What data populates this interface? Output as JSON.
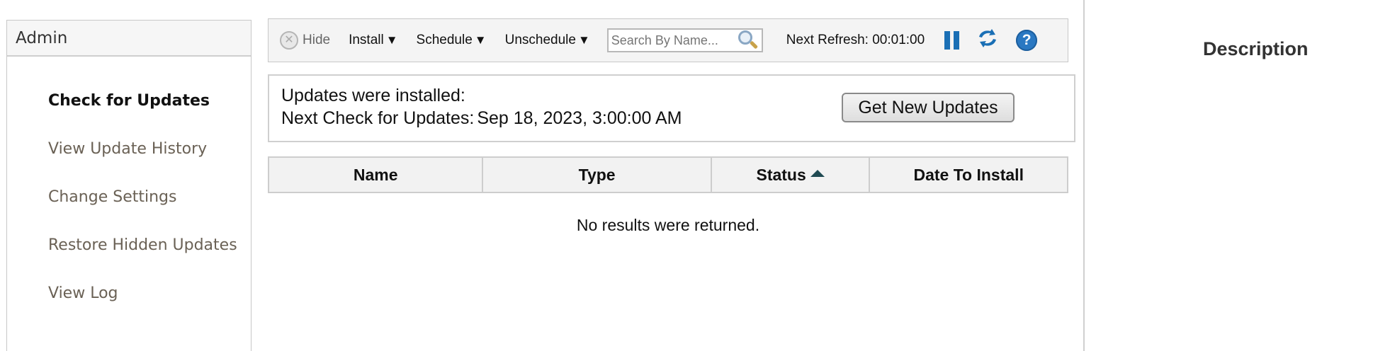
{
  "sidebar": {
    "title": "Admin",
    "items": [
      {
        "label": "Check for Updates"
      },
      {
        "label": "View Update History"
      },
      {
        "label": "Change Settings"
      },
      {
        "label": "Restore Hidden Updates"
      },
      {
        "label": "View Log"
      }
    ],
    "active_index": 0
  },
  "toolbar": {
    "hide_label": "Hide",
    "install_label": "Install",
    "schedule_label": "Schedule",
    "unschedule_label": "Unschedule",
    "caret": "▼",
    "search_placeholder": "Search By Name...",
    "refresh_text": "Next Refresh: 00:01:00",
    "icons": [
      "close-circle-icon",
      "search-icon",
      "pause-icon",
      "refresh-icon",
      "help-icon"
    ],
    "help_glyph": "?"
  },
  "info": {
    "installed_text": "Updates were installed:",
    "next_check_label": "Next Check for Updates:",
    "next_check_value": "Sep 18, 2023, 3:00:00 AM",
    "get_updates_label": "Get New Updates"
  },
  "table": {
    "columns": [
      "Name",
      "Type",
      "Status",
      "Date To Install"
    ],
    "sorted_column": "Status",
    "sort_direction": "ascending",
    "empty_message": "No results were returned."
  },
  "description": {
    "title": "Description"
  },
  "colors": {
    "accent_blue": "#1a6fb5",
    "sidebar_text": "#6a6155",
    "sort_arrow": "#1f4a52"
  }
}
